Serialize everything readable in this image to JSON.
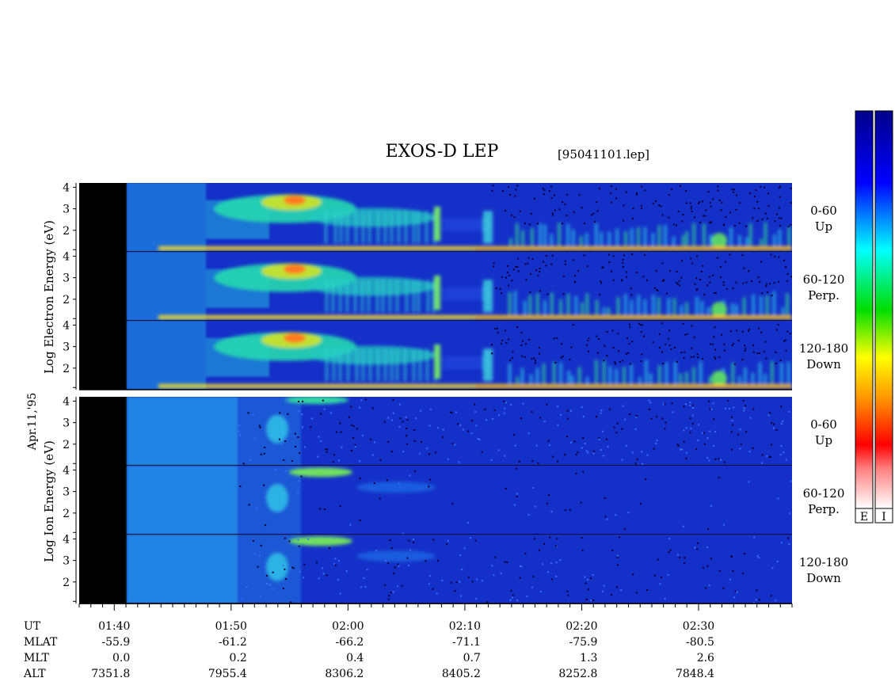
{
  "title": "EXOS-D LEP",
  "file_label": "[95041101.lep]",
  "date_label": "Apr.11,'95",
  "chart_data": [
    {
      "type": "heatmap",
      "group": "electron",
      "ylabel": "Log Electron Energy (eV)",
      "panels": [
        {
          "pitch_angle": "0-60",
          "direction": "Up",
          "yticks": [
            "4",
            "3",
            "2"
          ],
          "ylim": [
            1,
            4.2
          ]
        },
        {
          "pitch_angle": "60-120",
          "direction": "Perp.",
          "yticks": [
            "4",
            "3",
            "2"
          ],
          "ylim": [
            1,
            4.2
          ]
        },
        {
          "pitch_angle": "120-180",
          "direction": "Down",
          "yticks": [
            "4",
            "3",
            "2"
          ],
          "ylim": [
            1,
            4.2
          ]
        }
      ]
    },
    {
      "type": "heatmap",
      "group": "ion",
      "ylabel": "Log Ion Energy (eV)",
      "panels": [
        {
          "pitch_angle": "0-60",
          "direction": "Up",
          "yticks": [
            "4",
            "3",
            "2"
          ],
          "ylim": [
            1,
            4.2
          ]
        },
        {
          "pitch_angle": "60-120",
          "direction": "Perp.",
          "yticks": [
            "4",
            "3",
            "2"
          ],
          "ylim": [
            1,
            4.2
          ]
        },
        {
          "pitch_angle": "120-180",
          "direction": "Down",
          "yticks": [
            "4",
            "3",
            "2"
          ],
          "ylim": [
            1,
            4.2
          ]
        }
      ]
    }
  ],
  "time_axis": {
    "xlim": [
      "01:37",
      "02:38"
    ],
    "row_labels": [
      "UT",
      "MLAT",
      "MLT",
      "ALT"
    ],
    "ticks": [
      {
        "UT": "01:40",
        "MLAT": "-55.9",
        "MLT": "0.0",
        "ALT": "7351.8"
      },
      {
        "UT": "01:50",
        "MLAT": "-61.2",
        "MLT": "0.2",
        "ALT": "7955.4"
      },
      {
        "UT": "02:00",
        "MLAT": "-66.2",
        "MLT": "0.4",
        "ALT": "8306.2"
      },
      {
        "UT": "02:10",
        "MLAT": "-71.1",
        "MLT": "0.7",
        "ALT": "8405.2"
      },
      {
        "UT": "02:20",
        "MLAT": "-75.9",
        "MLT": "1.3",
        "ALT": "8252.8"
      },
      {
        "UT": "02:30",
        "MLAT": "-80.5",
        "MLT": "2.6",
        "ALT": "7848.4"
      }
    ]
  },
  "colorbars": [
    {
      "label": "E",
      "colormap": "white-red-orange-yellow-green-cyan-blue-navy"
    },
    {
      "label": "I",
      "colormap": "white-red-orange-yellow-green-cyan-blue-navy"
    }
  ],
  "colors": {
    "background_spectrum": "#1530c8",
    "data_gap": "#000000",
    "colormap_stops": [
      "#ffffff",
      "#ff0000",
      "#ff9900",
      "#ffff00",
      "#00dd00",
      "#00ffff",
      "#0000ff",
      "#00008a"
    ]
  }
}
